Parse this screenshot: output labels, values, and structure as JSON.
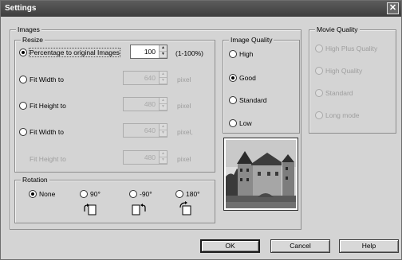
{
  "window": {
    "title": "Settings",
    "close_glyph": "✕"
  },
  "images": {
    "legend": "Images",
    "resize": {
      "legend": "Resize",
      "options": [
        {
          "label": "Percentage to original Images",
          "selected": true,
          "value": "100",
          "unit": "(1-100%)",
          "enabled": true
        },
        {
          "label": "Fit Width to",
          "selected": false,
          "value": "640",
          "unit": "pixel",
          "enabled": false
        },
        {
          "label": "Fit Height to",
          "selected": false,
          "value": "480",
          "unit": "pixel",
          "enabled": false
        },
        {
          "label": "Fit Width to",
          "selected": false,
          "value": "640",
          "unit": "pixel,",
          "enabled": false
        }
      ],
      "sub_label": "Fit Height to",
      "sub_value": "480",
      "sub_unit": "pixel"
    },
    "rotation": {
      "legend": "Rotation",
      "options": [
        {
          "label": "None",
          "selected": true
        },
        {
          "label": "90°",
          "selected": false,
          "icon": "rotate-cw-icon"
        },
        {
          "label": "-90°",
          "selected": false,
          "icon": "rotate-ccw-icon"
        },
        {
          "label": "180°",
          "selected": false,
          "icon": "rotate-180-icon"
        }
      ]
    }
  },
  "image_quality": {
    "legend": "Image Quality",
    "options": [
      {
        "label": "High",
        "selected": false
      },
      {
        "label": "Good",
        "selected": true
      },
      {
        "label": "Standard",
        "selected": false
      },
      {
        "label": "Low",
        "selected": false
      }
    ]
  },
  "movie_quality": {
    "legend": "Movie Quality",
    "options": [
      {
        "label": "High Plus Quality"
      },
      {
        "label": "High Quality"
      },
      {
        "label": "Standard"
      },
      {
        "label": "Long mode"
      }
    ]
  },
  "buttons": {
    "ok": "OK",
    "cancel": "Cancel",
    "help": "Help"
  }
}
